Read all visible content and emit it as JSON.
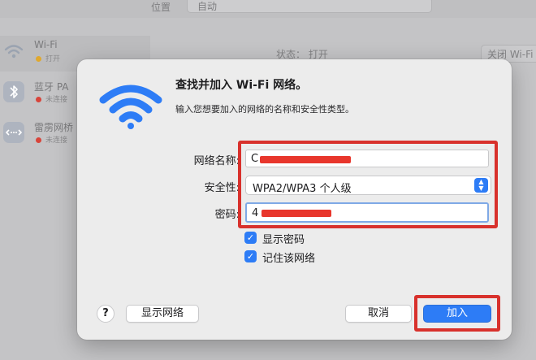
{
  "background": {
    "location_label": "位置",
    "location_value": "自动",
    "sidebar": [
      {
        "name": "Wi-Fi",
        "status": "打开",
        "status_color": "#e0a82e",
        "icon": "wifi-icon"
      },
      {
        "name": "蓝牙 PA",
        "status": "未连接",
        "status_color": "#d8443a",
        "icon": "bluetooth-icon"
      },
      {
        "name": "雷雳网桥",
        "status": "未连接",
        "status_color": "#d8443a",
        "icon": "thunderbolt-bridge-icon"
      }
    ],
    "status_text": "状态：  打开",
    "toggle_label": "关闭 Wi-Fi"
  },
  "dialog": {
    "title": "查找并加入 Wi-Fi 网络。",
    "subtitle": "输入您想要加入的网络的名称和安全性类型。",
    "network_name_label": "网络名称:",
    "network_name_prefix": "C",
    "security_label": "安全性:",
    "security_value": "WPA2/WPA3 个人级",
    "password_label": "密码:",
    "password_prefix": "4",
    "show_password_label": "显示密码",
    "remember_network_label": "记住该网络",
    "show_networks_button": "显示网络",
    "cancel_button": "取消",
    "join_button": "加入",
    "help_button": "?",
    "show_password_checked": true,
    "remember_network_checked": true
  },
  "colors": {
    "accent": "#2d7cf6",
    "highlight": "#d8312c",
    "redaction": "#e8362c"
  }
}
